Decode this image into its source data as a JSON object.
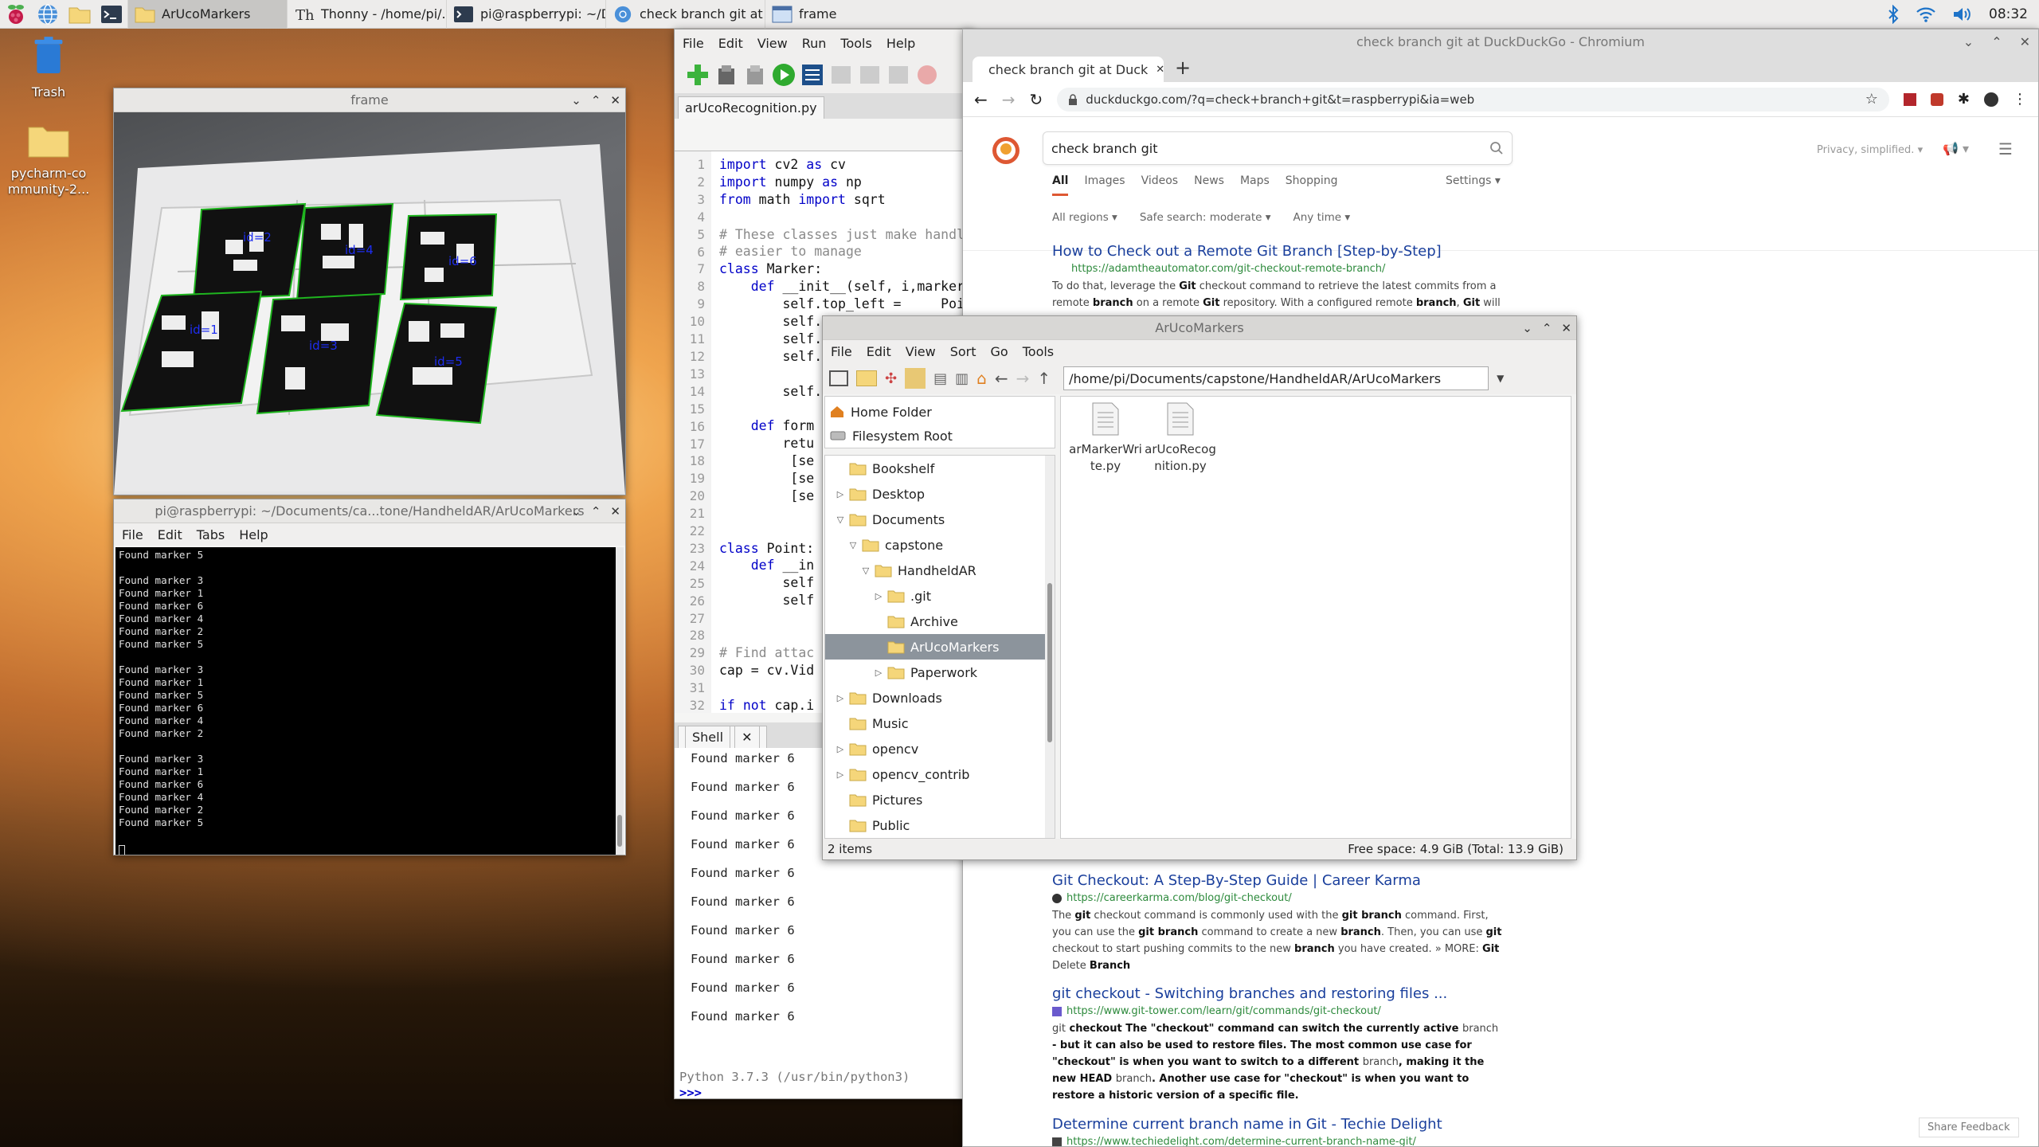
{
  "taskbar": {
    "tasks": [
      {
        "label": "ArUcoMarkers",
        "active": true
      },
      {
        "label": "Thonny  -  /home/pi/..."
      },
      {
        "label": "pi@raspberrypi: ~/Do..."
      },
      {
        "label": "check branch git at D..."
      },
      {
        "label": "frame"
      }
    ],
    "clock": "08:32"
  },
  "desktop": {
    "icons": [
      {
        "label": "Trash"
      },
      {
        "label": "pycharm-community-2..."
      }
    ]
  },
  "frame_window": {
    "title": "frame",
    "markers": [
      "id=2",
      "id=4",
      "id=6",
      "id=1",
      "id=3",
      "id=5"
    ]
  },
  "terminal": {
    "title": "pi@raspberrypi: ~/Documents/ca...tone/HandheldAR/ArUcoMarkers",
    "menu": [
      "File",
      "Edit",
      "Tabs",
      "Help"
    ],
    "lines": [
      "Found marker 5",
      "",
      "Found marker 3",
      "Found marker 1",
      "Found marker 6",
      "Found marker 4",
      "Found marker 2",
      "Found marker 5",
      "",
      "Found marker 3",
      "Found marker 1",
      "Found marker 5",
      "Found marker 6",
      "Found marker 4",
      "Found marker 2",
      "",
      "Found marker 3",
      "Found marker 1",
      "Found marker 6",
      "Found marker 4",
      "Found marker 2",
      "Found marker 5"
    ]
  },
  "thonny": {
    "menu": [
      "File",
      "Edit",
      "View",
      "Run",
      "Tools",
      "Help"
    ],
    "editor_tab": "arUcoRecognition.py",
    "line_numbers": [
      "1",
      "2",
      "3",
      "4",
      "5",
      "6",
      "7",
      "8",
      "9",
      "10",
      "11",
      "12",
      "13",
      "14",
      "15",
      "16",
      "17",
      "18",
      "19",
      "20",
      "21",
      "22",
      "23",
      "24",
      "25",
      "26",
      "27",
      "28",
      "29",
      "30",
      "31",
      "32"
    ],
    "code": [
      "import cv2 as cv",
      "import numpy as np",
      "from math import sqrt",
      "",
      "# These classes just make handling",
      "# easier to manage",
      "class Marker:",
      "    def __init__(self, i,marker):",
      "        self.top_left =     Point(",
      "        self.top_right =    Point(",
      "        self.bottom_right = Point(",
      "        self.",
      "",
      "        self.",
      "",
      "    def form",
      "        retu",
      "         [se",
      "         [se",
      "         [se",
      "",
      "",
      "class Point:",
      "    def __in",
      "        self",
      "        self",
      "",
      "",
      "# Find attac",
      "cap = cv.Vid",
      "",
      "if not cap.i"
    ],
    "shell_tab": "Shell",
    "shell_lines": [
      "Found marker 6",
      "Found marker 6",
      "Found marker 6",
      "Found marker 6",
      "Found marker 6",
      "Found marker 6",
      "Found marker 6",
      "Found marker 6",
      "Found marker 6",
      "Found marker 6"
    ],
    "python_version": "Python 3.7.3 (/usr/bin/python3)",
    "prompt": ">>>"
  },
  "chromium": {
    "window_title": "check branch git at DuckDuckGo - Chromium",
    "tab_title": "check branch git at Duck",
    "url": "duckduckgo.com/?q=check+branch+git&t=raspberrypi&ia=web",
    "search_query": "check branch git",
    "privacy_text": "Privacy, simplified.",
    "nav": [
      "All",
      "Images",
      "Videos",
      "News",
      "Maps",
      "Shopping"
    ],
    "settings": "Settings",
    "filters": [
      "All regions",
      "Safe search: moderate",
      "Any time"
    ],
    "results": [
      {
        "title": "How to Check out a Remote Git Branch [Step-by-Step]",
        "url": "https://adamtheautomator.com/git-checkout-remote-branch/",
        "snippet_parts": [
          "To do that, leverage the ",
          "Git",
          " checkout command to retrieve the latest commits from a remote ",
          "branch",
          " on a remote ",
          "Git",
          " repository. With a configured remote ",
          "branch",
          ", ",
          "Git",
          " will"
        ]
      },
      {
        "title": "Git Checkout: A Step-By-Step Guide | Career Karma",
        "url": "https://careerkarma.com/blog/git-checkout/",
        "snippet_parts": [
          "The ",
          "git",
          " checkout command is commonly used with the ",
          "git branch",
          " command. First, you can use the ",
          "git branch",
          " command to create a new ",
          "branch",
          ". Then, you can use ",
          "git",
          " checkout to start pushing commits to the new ",
          "branch",
          " you have created. » MORE: ",
          "Git",
          " Delete ",
          "Branch"
        ]
      },
      {
        "title": "git checkout - Switching branches and restoring files ...",
        "url": "https://www.git-tower.com/learn/git/commands/git-checkout/",
        "snippet_parts": [
          "git",
          " checkout The \"checkout\" command can switch the currently active ",
          "branch",
          " - but it can also be used to restore files. The most common use case for \"checkout\" is when you want to switch to a different ",
          "branch",
          ", making it the new HEAD ",
          "branch",
          ". Another use case for \"checkout\" is when you want to restore a historic version of a specific file."
        ]
      },
      {
        "title": "Determine current branch name in Git - Techie Delight",
        "url": "https://www.techiedelight.com/determine-current-branch-name-git/",
        "snippet_parts": []
      }
    ],
    "share_feedback": "Share Feedback"
  },
  "file_manager": {
    "title": "ArUcoMarkers",
    "menu": [
      "File",
      "Edit",
      "View",
      "Sort",
      "Go",
      "Tools"
    ],
    "path": "/home/pi/Documents/capstone/HandheldAR/ArUcoMarkers",
    "places": [
      "Home Folder",
      "Filesystem Root"
    ],
    "tree": [
      {
        "label": "Bookshelf",
        "depth": 0,
        "arrow": ""
      },
      {
        "label": "Desktop",
        "depth": 0,
        "arrow": "right"
      },
      {
        "label": "Documents",
        "depth": 0,
        "arrow": "down"
      },
      {
        "label": "capstone",
        "depth": 1,
        "arrow": "down"
      },
      {
        "label": "HandheldAR",
        "depth": 2,
        "arrow": "down"
      },
      {
        "label": ".git",
        "depth": 3,
        "arrow": "right"
      },
      {
        "label": "Archive",
        "depth": 3,
        "arrow": ""
      },
      {
        "label": "ArUcoMarkers",
        "depth": 3,
        "arrow": "",
        "selected": true
      },
      {
        "label": "Paperwork",
        "depth": 3,
        "arrow": "right"
      },
      {
        "label": "Downloads",
        "depth": 0,
        "arrow": "right"
      },
      {
        "label": "Music",
        "depth": 0,
        "arrow": ""
      },
      {
        "label": "opencv",
        "depth": 0,
        "arrow": "right"
      },
      {
        "label": "opencv_contrib",
        "depth": 0,
        "arrow": "right"
      },
      {
        "label": "Pictures",
        "depth": 0,
        "arrow": ""
      },
      {
        "label": "Public",
        "depth": 0,
        "arrow": ""
      }
    ],
    "files": [
      {
        "line1": "arMarkerWri",
        "line2": "te.py"
      },
      {
        "line1": "arUcoRecog",
        "line2": "nition.py"
      }
    ],
    "status_left": "2 items",
    "status_right": "Free space: 4.9 GiB (Total: 13.9 GiB)"
  }
}
